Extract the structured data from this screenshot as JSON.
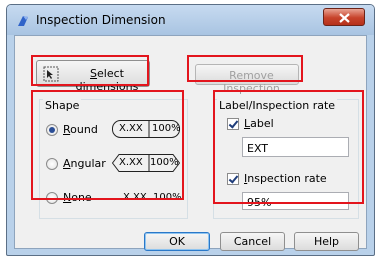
{
  "window": {
    "title": "Inspection Dimension",
    "close_icon": "close-icon"
  },
  "toolbar": {
    "select_label": "Select dimensions",
    "select_underline": "S",
    "select_rest": "elect dimensions",
    "remove_label": "Remove Inspection",
    "remove_pre": "R",
    "remove_ul": "e",
    "remove_rest": "move Inspection"
  },
  "shape": {
    "title": "Shape",
    "options": [
      {
        "ul": "R",
        "rest": "ound",
        "label": "Round",
        "selected": true
      },
      {
        "ul": "A",
        "rest": "ngular",
        "label": "Angular",
        "selected": false
      },
      {
        "ul": "N",
        "rest": "one",
        "label": "None",
        "selected": false
      }
    ],
    "sample_value": "X.XX",
    "sample_rate": "100%"
  },
  "label_rate": {
    "title": "Label/Inspection rate",
    "label_checkbox": {
      "ul": "L",
      "rest": "abel",
      "checked": true
    },
    "label_value": "EXT",
    "rate_checkbox": {
      "ul": "I",
      "rest": "nspection rate",
      "checked": true
    },
    "rate_value": "95%"
  },
  "buttons": {
    "ok": "OK",
    "cancel": "Cancel",
    "help": "Help"
  },
  "colors": {
    "highlight": "#e3151d",
    "title_bar": "#b9d1ea",
    "close_button": "#c7432b"
  }
}
